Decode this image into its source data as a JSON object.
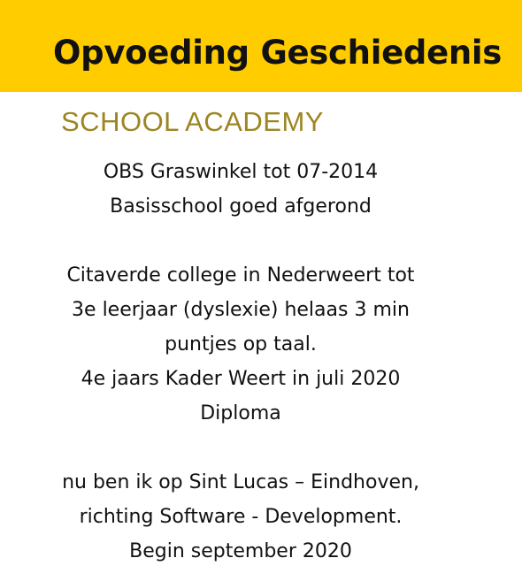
{
  "header": {
    "title": "Opvoeding Geschiedenis",
    "background_color": "#ffcc00"
  },
  "section": {
    "heading": "SCHOOL ACADEMY",
    "heading_color": "#9c8521"
  },
  "paragraphs": [
    {
      "lines": [
        "OBS Graswinkel tot 07-2014",
        "Basisschool goed afgerond"
      ]
    },
    {
      "lines": [
        "Citaverde college in Nederweert tot",
        "3e leerjaar (dyslexie) helaas 3 min",
        "puntjes op taal.",
        "4e jaars Kader Weert in juli 2020",
        "Diploma"
      ]
    },
    {
      "lines": [
        "nu ben ik op Sint Lucas – Eindhoven,",
        "richting Software - Development.",
        "Begin september 2020"
      ]
    }
  ]
}
